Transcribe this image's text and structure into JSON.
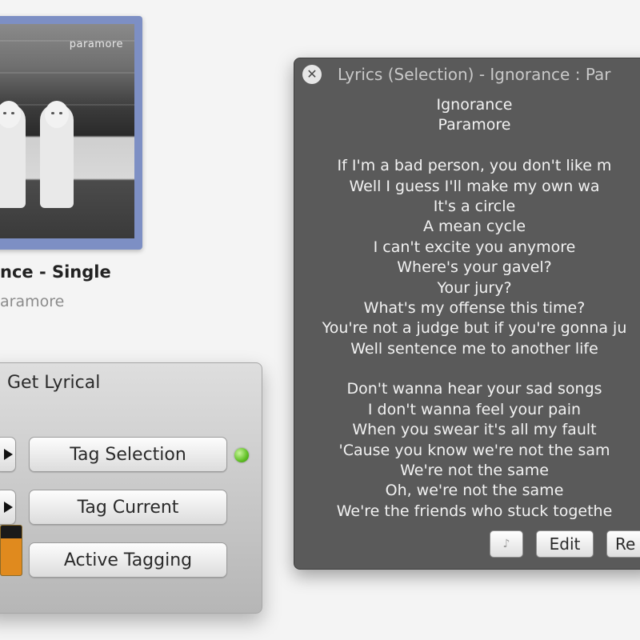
{
  "album": {
    "brand": "paramore",
    "title": "nce - Single",
    "artist": "aramore"
  },
  "panel": {
    "title": "Get Lyrical",
    "buttons": {
      "tag_selection": "Tag Selection",
      "tag_current": "Tag Current",
      "active_tagging": "Active Tagging"
    },
    "status_color": "#5fbf24",
    "meter_level": 0.75
  },
  "lyrics_window": {
    "title": "Lyrics (Selection) - Ignorance : Par",
    "lines": [
      "Ignorance",
      "Paramore",
      "",
      "If I'm a bad person, you don't like m",
      "Well I guess I'll make my own wa",
      "It's a circle",
      "A mean cycle",
      "I can't excite you anymore",
      "Where's your gavel?",
      "Your jury?",
      "What's my offense this time?",
      "You're not a judge but if you're gonna ju",
      "Well sentence me to another life",
      "",
      "Don't wanna hear your sad songs",
      "I don't wanna feel your pain",
      "When you swear it's all my fault",
      "'Cause you know we're not the sam",
      "We're not the same",
      "Oh, we're not the same",
      "We're the friends who stuck togethe"
    ],
    "buttons": {
      "edit": "Edit",
      "revert": "Re"
    }
  },
  "colors": {
    "window_bg": "#5a5a5a",
    "album_frame": "#7d8fc4",
    "meter": "#e08a1e"
  }
}
